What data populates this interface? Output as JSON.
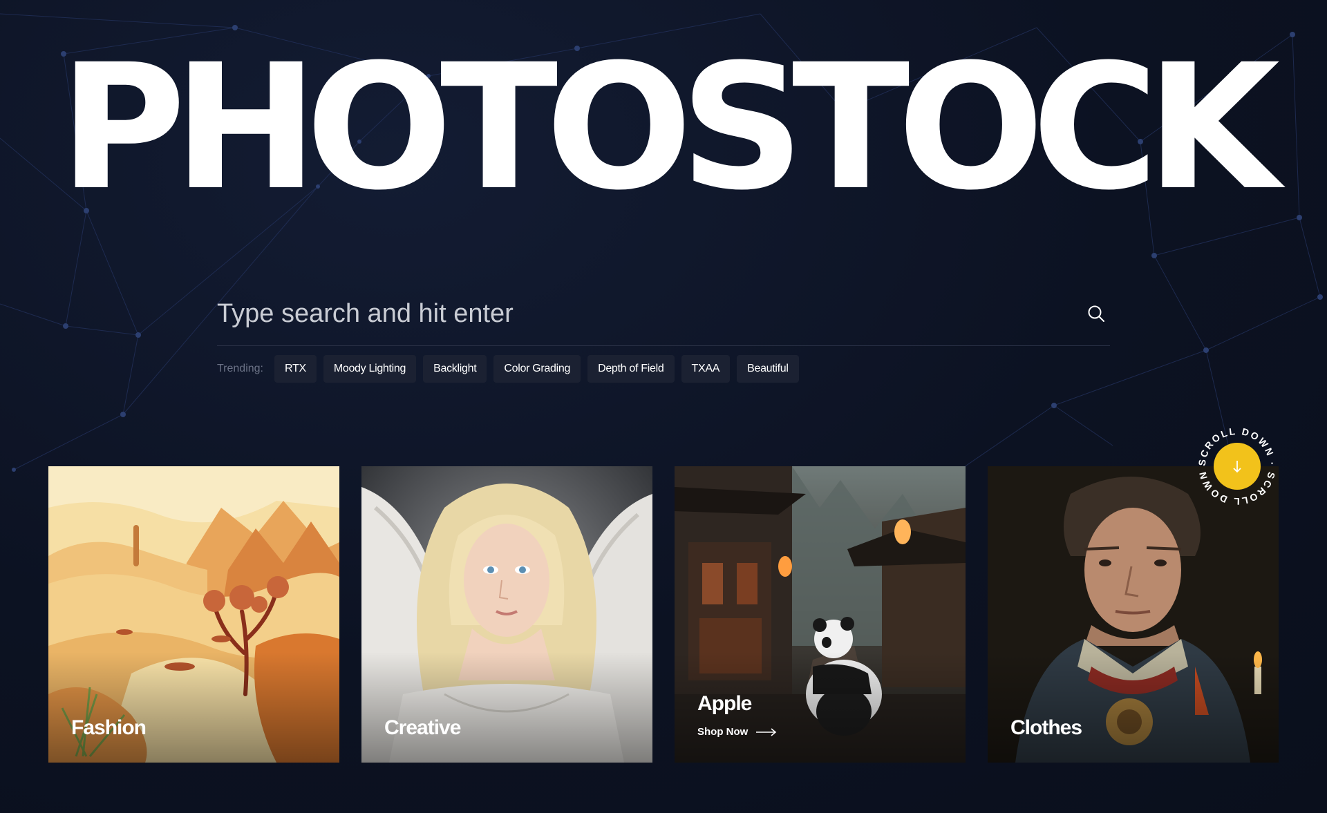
{
  "brand": {
    "title": "PHOTOSTOCK"
  },
  "search": {
    "placeholder": "Type search and hit enter",
    "icon": "search-icon"
  },
  "trending": {
    "label": "Trending:",
    "tags": [
      "RTX",
      "Moody Lighting",
      "Backlight",
      "Color Grading",
      "Depth of Field",
      "TXAA",
      "Beautiful"
    ]
  },
  "cards": [
    {
      "title": "Fashion",
      "art": "desert-landscape-illustration"
    },
    {
      "title": "Creative",
      "art": "angel-portrait"
    },
    {
      "title": "Apple",
      "link": "Shop Now",
      "art": "panda-village-scene",
      "link_icon": "arrow-right-icon"
    },
    {
      "title": "Clothes",
      "art": "man-portrait"
    }
  ],
  "scroll_badge": {
    "text": "SCROLL DOWN · SCROLL DOWN · ",
    "icon": "arrow-down-icon",
    "color": "#f2c21b"
  },
  "colors": {
    "background": "#0c1222",
    "tag_background": "#1b2132",
    "accent": "#f2c21b"
  }
}
